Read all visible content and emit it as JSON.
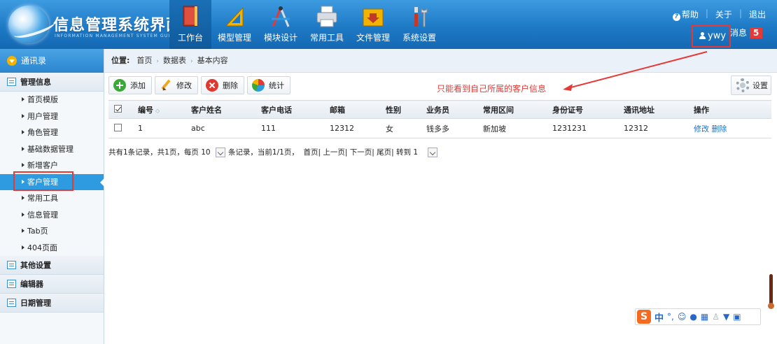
{
  "app": {
    "title": "信息管理系统界面",
    "subtitle": "INFORMATION MANAGEMENT SYSTEM GUI"
  },
  "nav": [
    {
      "label": "工作台",
      "icon": "book-icon",
      "active": true
    },
    {
      "label": "模型管理",
      "icon": "ruler-icon"
    },
    {
      "label": "模块设计",
      "icon": "compass-icon"
    },
    {
      "label": "常用工具",
      "icon": "printer-icon"
    },
    {
      "label": "文件管理",
      "icon": "folder-icon"
    },
    {
      "label": "系统设置",
      "icon": "tools-icon"
    }
  ],
  "top_links": {
    "help": "帮助",
    "about": "关于",
    "logout": "退出"
  },
  "user": {
    "name": "ywy",
    "messages_label": "消息",
    "message_count": "5"
  },
  "sidebar": {
    "header": "通讯录",
    "sections": [
      {
        "label": "管理信息",
        "items": [
          {
            "label": "首页模版"
          },
          {
            "label": "用户管理"
          },
          {
            "label": "角色管理"
          },
          {
            "label": "基础数据管理"
          },
          {
            "label": "新增客户"
          },
          {
            "label": "客户管理",
            "active": true
          },
          {
            "label": "常用工具"
          },
          {
            "label": "信息管理"
          },
          {
            "label": "Tab页"
          },
          {
            "label": "404页面"
          }
        ]
      },
      {
        "label": "其他设置"
      },
      {
        "label": "编辑器"
      },
      {
        "label": "日期管理"
      }
    ]
  },
  "breadcrumb": {
    "prefix": "位置:",
    "items": [
      "首页",
      "数据表",
      "基本内容"
    ]
  },
  "toolbar": {
    "add": "添加",
    "edit": "修改",
    "delete": "删除",
    "stats": "统计",
    "settings": "设置"
  },
  "annotation": "只能看到自己所属的客户信息",
  "table": {
    "columns": [
      "编号",
      "客户姓名",
      "客户电话",
      "邮箱",
      "性别",
      "业务员",
      "常用区间",
      "身份证号",
      "通讯地址",
      "操作"
    ],
    "rows": [
      {
        "id": "1",
        "name": "abc",
        "phone": "111",
        "email": "12312",
        "gender": "女",
        "salesman": "钱多多",
        "range": "新加坡",
        "idcard": "1231231",
        "address": "12312",
        "edit": "修改",
        "delete": "删除"
      }
    ]
  },
  "pager": {
    "part1": "共有1条记录，共1页，每页",
    "page_size": "10",
    "part2": "条记录，当前1/1页，",
    "nav": "首页| 上一页| 下一页| 尾页| 转到",
    "goto": "1"
  },
  "ime": {
    "logo": "S",
    "lang": "中",
    "punct": "°,"
  },
  "colors": {
    "header": "#1e7ac6",
    "accent": "#2e9be0",
    "annotation": "#e53935",
    "badge": "#e53935"
  }
}
